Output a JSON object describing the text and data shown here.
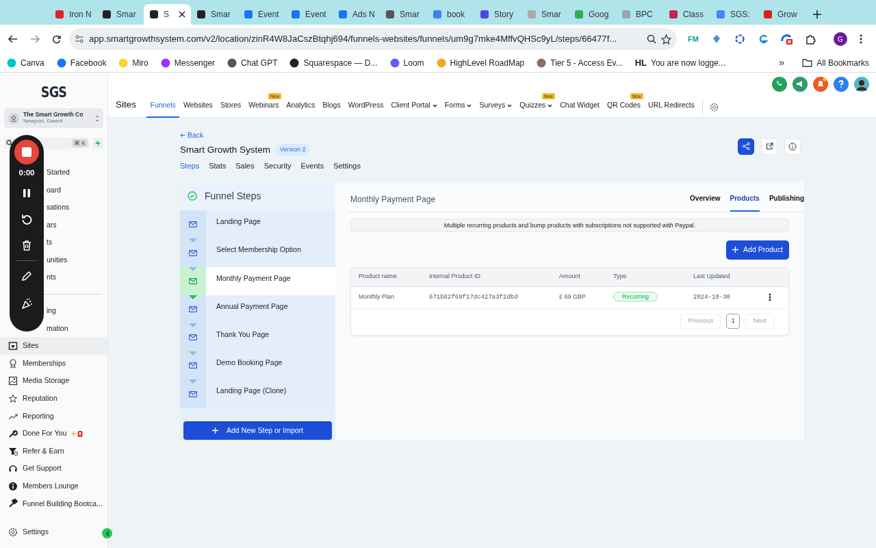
{
  "browser": {
    "tabs": [
      {
        "title": "Iron N",
        "selected": false
      },
      {
        "title": "Smar",
        "selected": false
      },
      {
        "title": "S",
        "selected": true
      },
      {
        "title": "Smar",
        "selected": false
      },
      {
        "title": "Event",
        "selected": false
      },
      {
        "title": "Event",
        "selected": false
      },
      {
        "title": "Ads N",
        "selected": false
      },
      {
        "title": "Smar",
        "selected": false
      },
      {
        "title": "book",
        "selected": false
      },
      {
        "title": "Story",
        "selected": false
      },
      {
        "title": "Smar",
        "selected": false
      },
      {
        "title": "Goog",
        "selected": false
      },
      {
        "title": "BPC",
        "selected": false
      },
      {
        "title": "Class",
        "selected": false
      },
      {
        "title": "SGS:",
        "selected": false
      },
      {
        "title": "Grow",
        "selected": false
      }
    ],
    "address": "app.smartgrowthsystem.com/v2/location/zinR4W8JaCszBtqhj694/funnels-websites/funnels/um9g7mke4MffvQHSc9yL/steps/66477f...",
    "extension_label": "FM",
    "profile_initial": "G",
    "bookmarks": [
      {
        "label": "Canva"
      },
      {
        "label": "Facebook"
      },
      {
        "label": "Miro"
      },
      {
        "label": "Messenger"
      },
      {
        "label": "Chat GPT"
      },
      {
        "label": "Squarespace — D..."
      },
      {
        "label": "Loom"
      },
      {
        "label": "HighLevel RoadMap"
      },
      {
        "label": "Tier 5 - Access Ev..."
      },
      {
        "label": "You are now logge...",
        "prefix": "HL"
      }
    ],
    "more": "»",
    "all_bookmarks": "All Bookmarks"
  },
  "recorder": {
    "time": "0:00"
  },
  "sidebar": {
    "logo": "SGS",
    "account": {
      "name": "The Smart Growth Co",
      "location": "Newport, Gwent"
    },
    "search_shortcut": "⌘ K",
    "sections": [
      {
        "items": [
          {
            "label": "Started",
            "selected": false
          },
          {
            "label": "oard",
            "selected": false
          },
          {
            "label": "sations",
            "selected": false
          },
          {
            "label": "ars",
            "selected": false
          },
          {
            "label": "ts",
            "selected": false
          },
          {
            "label": "unities",
            "selected": false
          },
          {
            "label": "nts",
            "selected": false
          }
        ]
      },
      {
        "items": [
          {
            "label": "ing",
            "selected": false
          },
          {
            "label": "mation",
            "selected": false
          },
          {
            "label": "Sites",
            "selected": true
          },
          {
            "label": "Memberships",
            "selected": false
          },
          {
            "label": "Media Storage",
            "selected": false
          },
          {
            "label": "Reputation",
            "selected": false
          },
          {
            "label": "Reporting",
            "selected": false
          },
          {
            "label": "Done For You",
            "selected": false,
            "emoji": true
          },
          {
            "label": "Refer & Earn",
            "selected": false
          },
          {
            "label": "Get Support",
            "selected": false
          },
          {
            "label": "Members Lounge",
            "selected": false
          },
          {
            "label": "Funnel Building Bootca...",
            "selected": false
          }
        ]
      }
    ],
    "settings": "Settings"
  },
  "header": {
    "title": "Sites",
    "nav": [
      {
        "label": "Funnels",
        "selected": true
      },
      {
        "label": "Websites",
        "selected": false
      },
      {
        "label": "Stores",
        "selected": false
      },
      {
        "label": "Webinars",
        "selected": false,
        "badge": "New"
      },
      {
        "label": "Analytics",
        "selected": false
      },
      {
        "label": "Blogs",
        "selected": false
      },
      {
        "label": "WordPress",
        "selected": false
      },
      {
        "label": "Client Portal",
        "selected": false,
        "dropdown": true
      },
      {
        "label": "Forms",
        "selected": false,
        "dropdown": true
      },
      {
        "label": "Surveys",
        "selected": false,
        "dropdown": true
      },
      {
        "label": "Quizzes",
        "selected": false,
        "dropdown": true,
        "badge": "New"
      },
      {
        "label": "Chat Widget",
        "selected": false
      },
      {
        "label": "QR Codes",
        "selected": false,
        "badge": "New"
      },
      {
        "label": "URL Redirects",
        "selected": false
      }
    ]
  },
  "funnel": {
    "back": "Back",
    "title": "Smart Growth System",
    "version": "Version 2",
    "tabs": [
      {
        "label": "Steps",
        "selected": true
      },
      {
        "label": "Stats",
        "selected": false
      },
      {
        "label": "Sales",
        "selected": false
      },
      {
        "label": "Security",
        "selected": false
      },
      {
        "label": "Events",
        "selected": false
      },
      {
        "label": "Settings",
        "selected": false
      }
    ],
    "steps_title": "Funnel Steps",
    "steps": [
      {
        "name": "Landing Page",
        "selected": false
      },
      {
        "name": "Select Membership Option",
        "selected": false
      },
      {
        "name": "Monthly Payment Page",
        "selected": true
      },
      {
        "name": "Annual Payment Page",
        "selected": false
      },
      {
        "name": "Thank You Page",
        "selected": false
      },
      {
        "name": "Demo Booking Page",
        "selected": false
      },
      {
        "name": "Landing Page (Clone)",
        "selected": false
      }
    ],
    "add_step": "Add New Step or Import"
  },
  "page": {
    "title": "Monthly Payment Page",
    "tabs": [
      {
        "label": "Overview",
        "selected": false
      },
      {
        "label": "Products",
        "selected": true
      },
      {
        "label": "Publishing",
        "selected": false
      }
    ],
    "notice": "Multiple recurring products and bump products with subscriptions not supported with Paypal.",
    "add_product": "Add Product",
    "table": {
      "columns": [
        "Product name",
        "Internal Product ID",
        "Amount",
        "Type",
        "Last Updated"
      ],
      "rows": [
        {
          "product_name": "Monthly Plan",
          "internal_id": "671b82f69f17dc427a3f2dbd",
          "amount": "£ 69 GBP",
          "type": "Recurring",
          "last_updated": "2024-10-30"
        }
      ]
    },
    "pagination": {
      "previous": "Previous",
      "page": "1",
      "next": "Next",
      "previous_disabled": true,
      "next_disabled": true
    }
  }
}
